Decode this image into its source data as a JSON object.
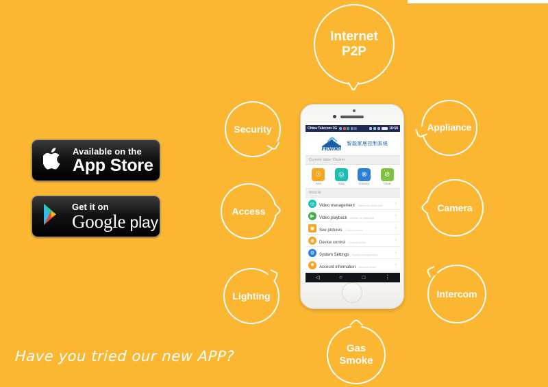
{
  "background_color": "#FBB731",
  "accent_color": "#FFFFFF",
  "tagline": "Have you tried our new APP?",
  "bubbles": [
    {
      "id": "internet-p2p",
      "line1": "Internet",
      "line2": "P2P"
    },
    {
      "id": "security",
      "label": "Security"
    },
    {
      "id": "appliance",
      "label": "Appliance"
    },
    {
      "id": "access",
      "label": "Access"
    },
    {
      "id": "camera",
      "label": "Camera"
    },
    {
      "id": "lighting",
      "label": "Lighting"
    },
    {
      "id": "intercom",
      "label": "Intercom"
    },
    {
      "id": "gas-smoke",
      "line1": "Gas",
      "line2": "Smoke"
    }
  ],
  "badges": {
    "app_store": {
      "small": "Available on the",
      "big": "App Store",
      "icon": "apple-icon"
    },
    "google_play": {
      "small": "Get it on",
      "big": "Google",
      "big2": "play",
      "icon": "google-play-triangle-icon"
    }
  },
  "phone": {
    "status_bar": {
      "carrier": "China Telecom 3G",
      "time": "16:58"
    },
    "logo": {
      "wordmark": "Homei",
      "subtitle": "智能家居控制系统"
    },
    "current_state": "Current state: Disarm",
    "actions": [
      {
        "label": "Arm",
        "color": "#F5A623",
        "glyph": "☉"
      },
      {
        "label": "Stay",
        "color": "#1BBFB0",
        "glyph": "◎"
      },
      {
        "label": "Disarm",
        "color": "#2B7FD4",
        "glyph": "⊗"
      },
      {
        "label": "Clear",
        "color": "#7FC241",
        "glyph": "⊘"
      }
    ],
    "module_header": "Module",
    "modules": [
      {
        "title": "Video management",
        "sub": "Watch the video live",
        "color": "#1BBFB0",
        "glyph": "◎"
      },
      {
        "title": "Video playback",
        "sub": "Watch the playback",
        "color": "#3FAE49",
        "glyph": "▶"
      },
      {
        "title": "See pictures",
        "sub": "Capture photo",
        "color": "#F5A623",
        "glyph": "▣"
      },
      {
        "title": "Device control",
        "sub": "Control device",
        "color": "#F5A623",
        "glyph": "◉"
      },
      {
        "title": "System Settings",
        "sub": "System configuration",
        "color": "#2B7FD4",
        "glyph": "⚙"
      },
      {
        "title": "Account information",
        "sub": "Account detail",
        "color": "#F5A623",
        "glyph": "☻"
      }
    ],
    "nav": {
      "back": "◁",
      "home": "○",
      "recents": "□",
      "menu": "⋮"
    }
  }
}
